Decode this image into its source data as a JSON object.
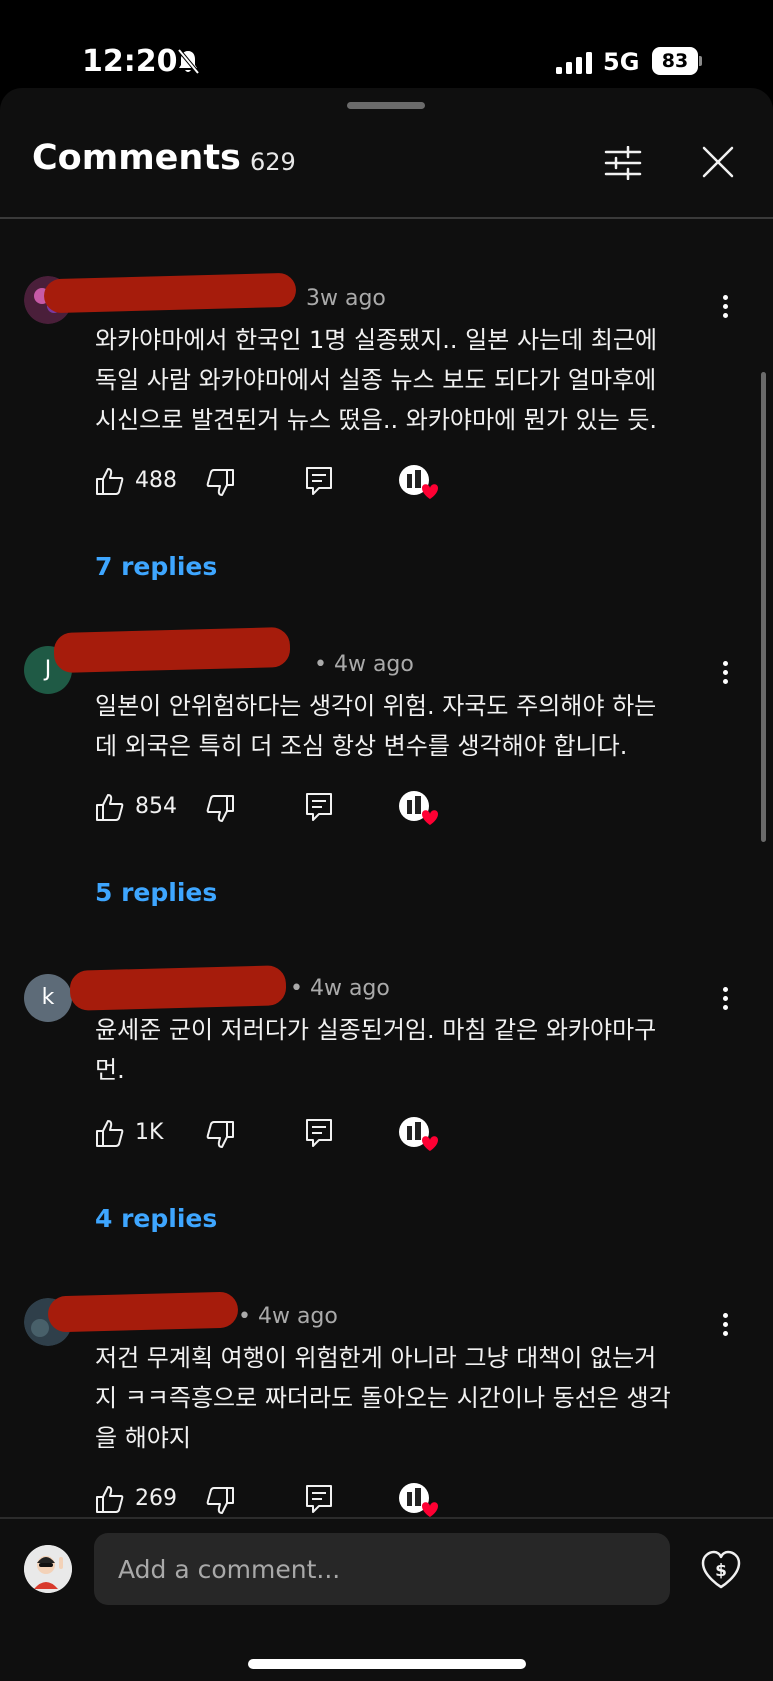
{
  "status": {
    "time": "12:20",
    "network": "5G",
    "battery": "83",
    "icons": [
      "bell-off-icon",
      "signal-icon",
      "battery-icon"
    ]
  },
  "header": {
    "title": "Comments",
    "count": "629",
    "icons": [
      "filter-icon",
      "close-icon"
    ]
  },
  "comments": [
    {
      "time": "3w ago",
      "text": [
        "와카야마에서 한국인 1명 실종됐지.. 일본 사는데 최근에",
        "독일 사람 와카야마에서 실종 뉴스 보도 되다가 얼마후에",
        "시신으로 발견된거 뉴스 떴음.. 와카야마에 뭔가 있는 듯."
      ],
      "likes": "488",
      "replies": "7 replies"
    },
    {
      "avatar": "J",
      "time": "• 4w ago",
      "text": [
        "일본이 안위험하다는 생각이 위험. 자국도 주의해야 하는",
        "데 외국은 특히 더 조심 항상 변수를 생각해야 합니다."
      ],
      "likes": "854",
      "replies": "5 replies"
    },
    {
      "avatar": "k",
      "time": "• 4w ago",
      "text": [
        "윤세준 군이 저러다가 실종된거임. 마침 같은 와카야마구",
        "먼."
      ],
      "likes": "1K",
      "replies": "4 replies"
    },
    {
      "time": "• 4w ago",
      "text": [
        "저건 무계획 여행이 위험한게 아니라 그냥 대책이 없는거",
        "지 ㅋㅋ즉흥으로 짜더라도 돌아오는 시간이나 동선은 생각",
        "을 해야지"
      ],
      "likes": "269"
    }
  ],
  "composer": {
    "placeholder": "Add a comment...",
    "icons": [
      "avatar-icon",
      "super-thanks-icon"
    ]
  },
  "colors": {
    "background": "#0f0f0f",
    "link": "#3ea6ff",
    "redaction": "#a61c0c",
    "heart": "#ff0033"
  }
}
